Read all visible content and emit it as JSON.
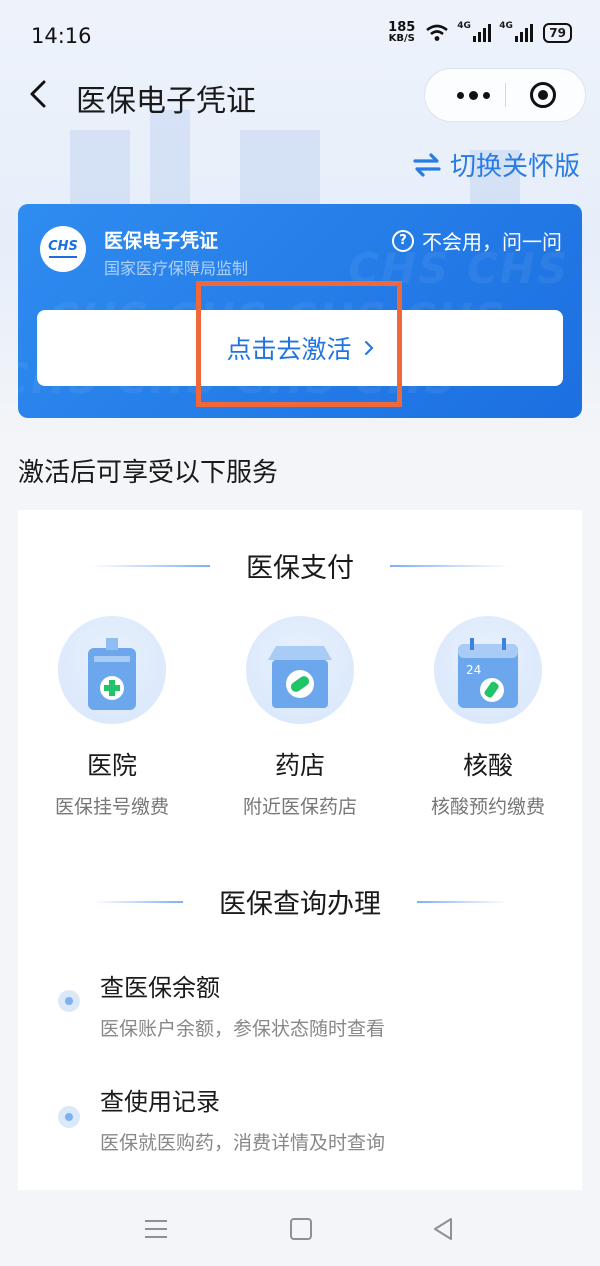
{
  "status_bar": {
    "time": "14:16",
    "net_speed_value": "185",
    "net_speed_unit": "KB/S",
    "signal1_label": "4G",
    "signal2_label": "4G",
    "battery": "79"
  },
  "nav": {
    "title": "医保电子凭证"
  },
  "care_switch_label": "切换关怀版",
  "card": {
    "logo_text": "CHS",
    "title": "医保电子凭证",
    "subtitle": "国家医疗保障局监制",
    "help_label": "不会用，问一问",
    "activate_label": "点击去激活"
  },
  "services_heading": "激活后可享受以下服务",
  "payment": {
    "title": "医保支付",
    "items": [
      {
        "name": "医院",
        "desc": "医保挂号缴费",
        "icon": "hospital-icon"
      },
      {
        "name": "药店",
        "desc": "附近医保药店",
        "icon": "pharmacy-icon"
      },
      {
        "name": "核酸",
        "desc": "核酸预约缴费",
        "icon": "nucleic-test-icon"
      }
    ]
  },
  "query": {
    "title": "医保查询办理",
    "items": [
      {
        "title": "查医保余额",
        "desc": "医保账户余额，参保状态随时查看"
      },
      {
        "title": "查使用记录",
        "desc": "医保就医购药，消费详情及时查询"
      }
    ]
  },
  "colors": {
    "accent": "#2a7be4",
    "card_blue": "#1f73e2",
    "highlight": "#f0683a"
  }
}
